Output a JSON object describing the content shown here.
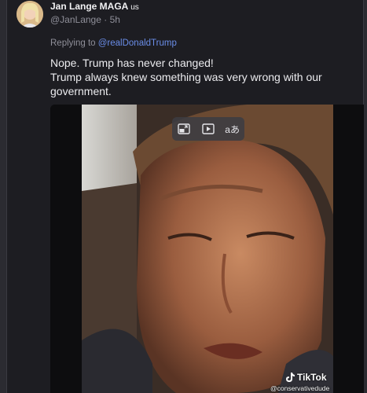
{
  "post": {
    "author_name": "Jan Lange MAGA",
    "author_flag": "us",
    "author_handle": "@JanLange",
    "separator": "·",
    "time_ago": "5h",
    "reply_prefix": "Replying to",
    "reply_mention": "@realDonaldTrump",
    "text_lines": [
      "Nope. Trump has never changed!",
      "Trump always knew something was very wrong with our",
      "government."
    ]
  },
  "media": {
    "watermark_brand": "TikTok",
    "watermark_user": "@conservativedude",
    "controls": [
      "picture-in-picture-icon",
      "play-preview-icon",
      "translate-icon"
    ],
    "translate_glyph": "aあ"
  }
}
